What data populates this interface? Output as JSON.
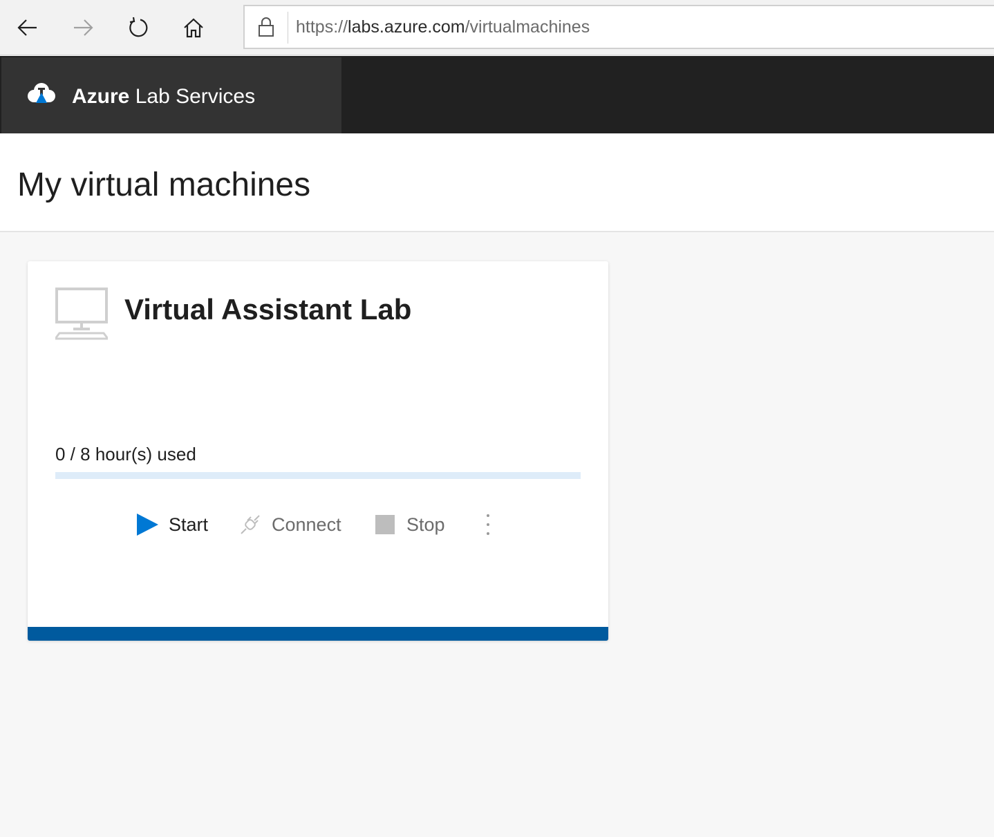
{
  "browser": {
    "url_scheme": "https://",
    "url_host": "labs.azure.com",
    "url_path": "/virtualmachines",
    "icons": [
      "back-arrow-icon",
      "forward-arrow-icon",
      "refresh-icon",
      "home-icon",
      "lock-icon"
    ]
  },
  "header": {
    "brand_bold": "Azure",
    "brand_rest": " Lab Services",
    "logo_icon": "azure-lab-cloud-icon",
    "colors": {
      "bar": "#212121",
      "brand_panel": "#333333",
      "logo_accent": "#0078d4"
    }
  },
  "page": {
    "title": "My virtual machines"
  },
  "vm_card": {
    "name": "Virtual Assistant Lab",
    "icon": "computer-monitor-icon",
    "usage_text": "0 / 8 hour(s) used",
    "hours_used": 0,
    "hours_total": 8,
    "actions": {
      "start_label": "Start",
      "connect_label": "Connect",
      "stop_label": "Stop",
      "more_icon": "more-vertical-icon"
    },
    "colors": {
      "accent": "#0078d4",
      "footer": "#005a9e",
      "track": "#deecf9",
      "disabled": "#bdbdbd"
    }
  }
}
